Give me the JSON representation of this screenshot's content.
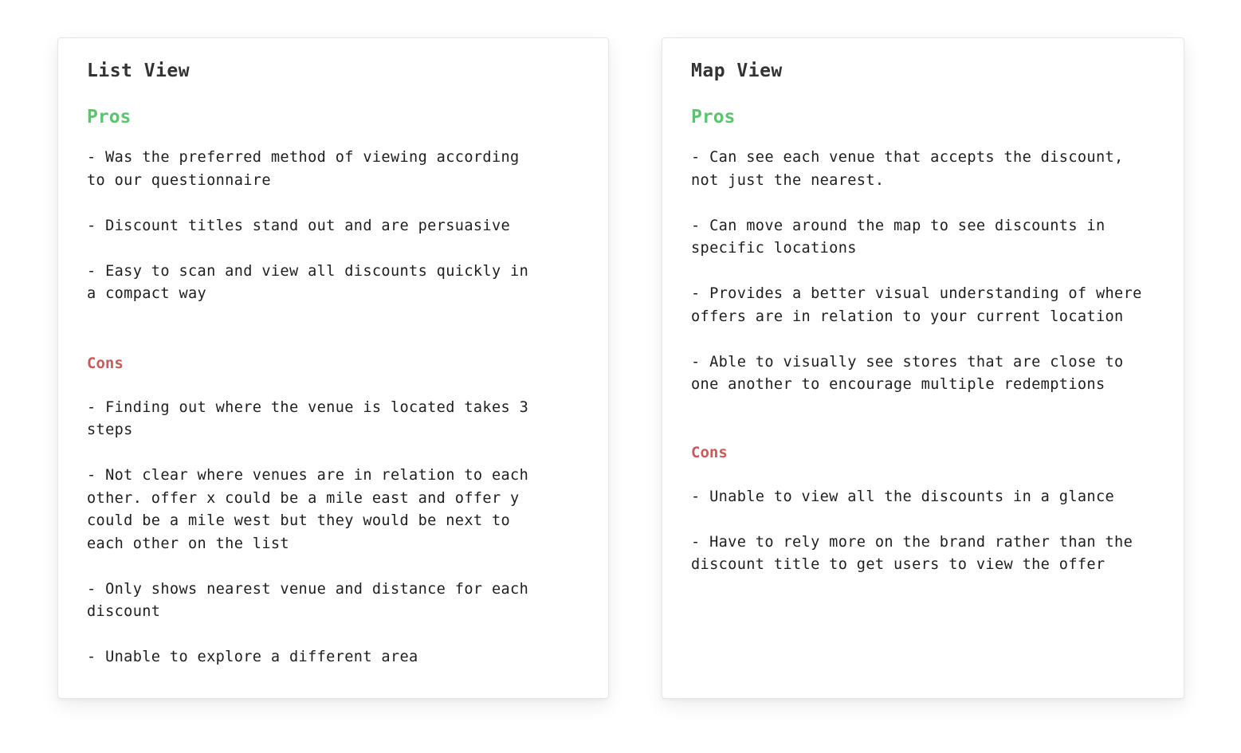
{
  "cards": [
    {
      "title": "List View",
      "pros_label": "Pros",
      "pros": [
        "- Was the preferred method of viewing according\nto our questionnaire",
        "- Discount titles stand out and are persuasive",
        "- Easy to scan and view all discounts quickly in\na compact way"
      ],
      "cons_label": "Cons",
      "cons": [
        "- Finding out where the venue is located takes 3\nsteps",
        "- Not clear where venues are in relation to each\nother. offer x could be a mile east and offer y\ncould be a mile west but they would be next to\neach other on the list",
        "- Only shows nearest venue and distance for each\ndiscount",
        "- Unable to explore a different area"
      ]
    },
    {
      "title": "Map View",
      "pros_label": "Pros",
      "pros": [
        "- Can see each venue that accepts the discount,\nnot just the nearest.",
        "- Can move around the map to see discounts in\nspecific locations",
        "- Provides a better visual understanding of where\noffers are in relation to your current location",
        "- Able to visually see stores that are close to\none another to encourage multiple redemptions"
      ],
      "cons_label": "Cons",
      "cons": [
        "- Unable to view all the discounts in a glance",
        "- Have to rely more on the brand rather than the\ndiscount title to get users to view the offer"
      ]
    }
  ],
  "colors": {
    "pros": "#5cc46f",
    "cons": "#c75a5a",
    "title": "#333333",
    "text": "#1e1e1e"
  }
}
